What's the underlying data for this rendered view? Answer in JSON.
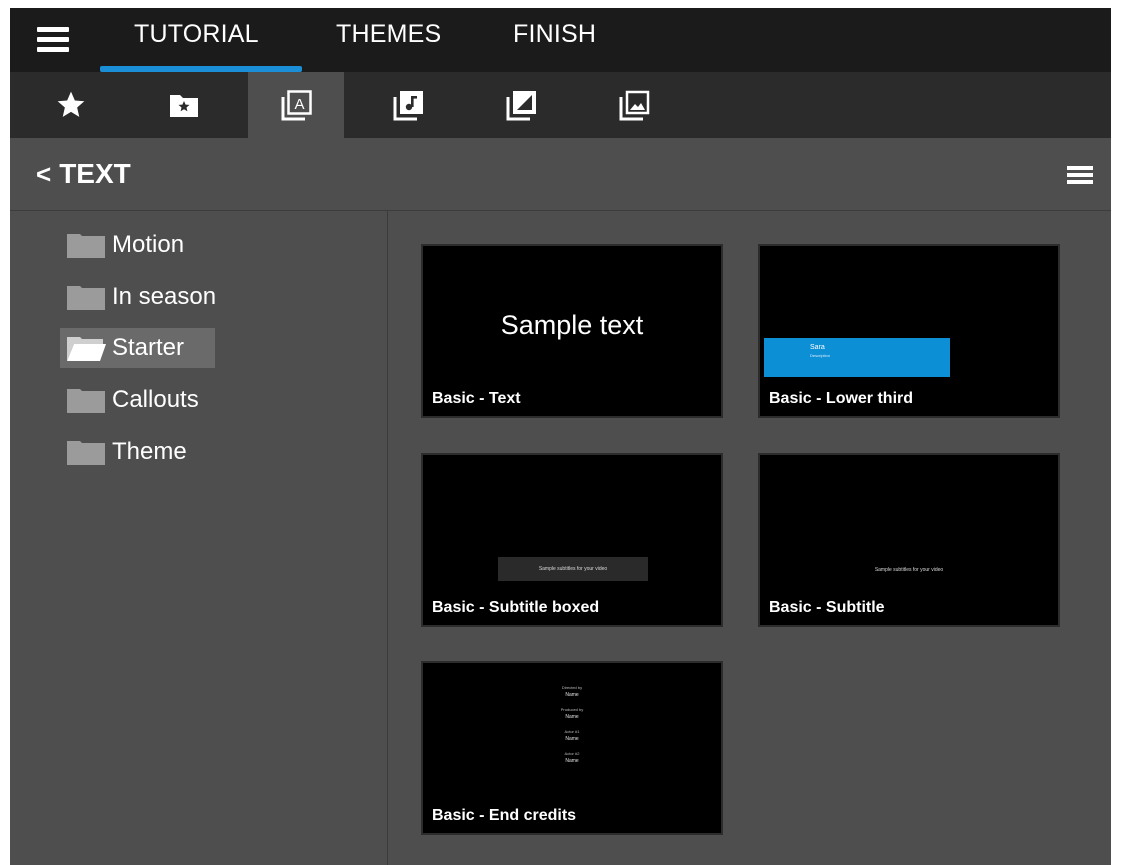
{
  "topnav": {
    "tabs": [
      {
        "label": "TUTORIAL",
        "active": true
      },
      {
        "label": "THEMES",
        "active": false
      },
      {
        "label": "FINISH",
        "active": false
      }
    ]
  },
  "iconbar": {
    "icons": [
      "star-icon",
      "folder-star-icon",
      "text-icon",
      "music-icon",
      "overlay-icon",
      "image-icon"
    ],
    "active": "text-icon"
  },
  "section": {
    "back_chevron": "<",
    "title": "TEXT"
  },
  "sidebar": {
    "folders": [
      {
        "label": "Motion",
        "selected": false
      },
      {
        "label": "In season",
        "selected": false
      },
      {
        "label": "Starter",
        "selected": true
      },
      {
        "label": "Callouts",
        "selected": false
      },
      {
        "label": "Theme",
        "selected": false
      }
    ]
  },
  "cards": [
    {
      "label": "Basic - Text",
      "preview_text": "Sample text"
    },
    {
      "label": "Basic - Lower third",
      "preview_name": "Sara",
      "preview_desc": "Description"
    },
    {
      "label": "Basic - Subtitle boxed",
      "preview_text": "Sample subtitles for your video"
    },
    {
      "label": "Basic - Subtitle",
      "preview_text": "Sample subtitles for your video"
    },
    {
      "label": "Basic - End credits",
      "credits": [
        {
          "role": "Directed by",
          "name": "Name"
        },
        {
          "role": "Produced by",
          "name": "Name"
        },
        {
          "role": "Actor #1",
          "name": "Name"
        },
        {
          "role": "Actor #2",
          "name": "Name"
        }
      ]
    }
  ],
  "colors": {
    "accent": "#1a8fd8",
    "panel": "#4e4e4e",
    "topbar": "#1b1b1b",
    "iconbar": "#2b2b2b"
  }
}
